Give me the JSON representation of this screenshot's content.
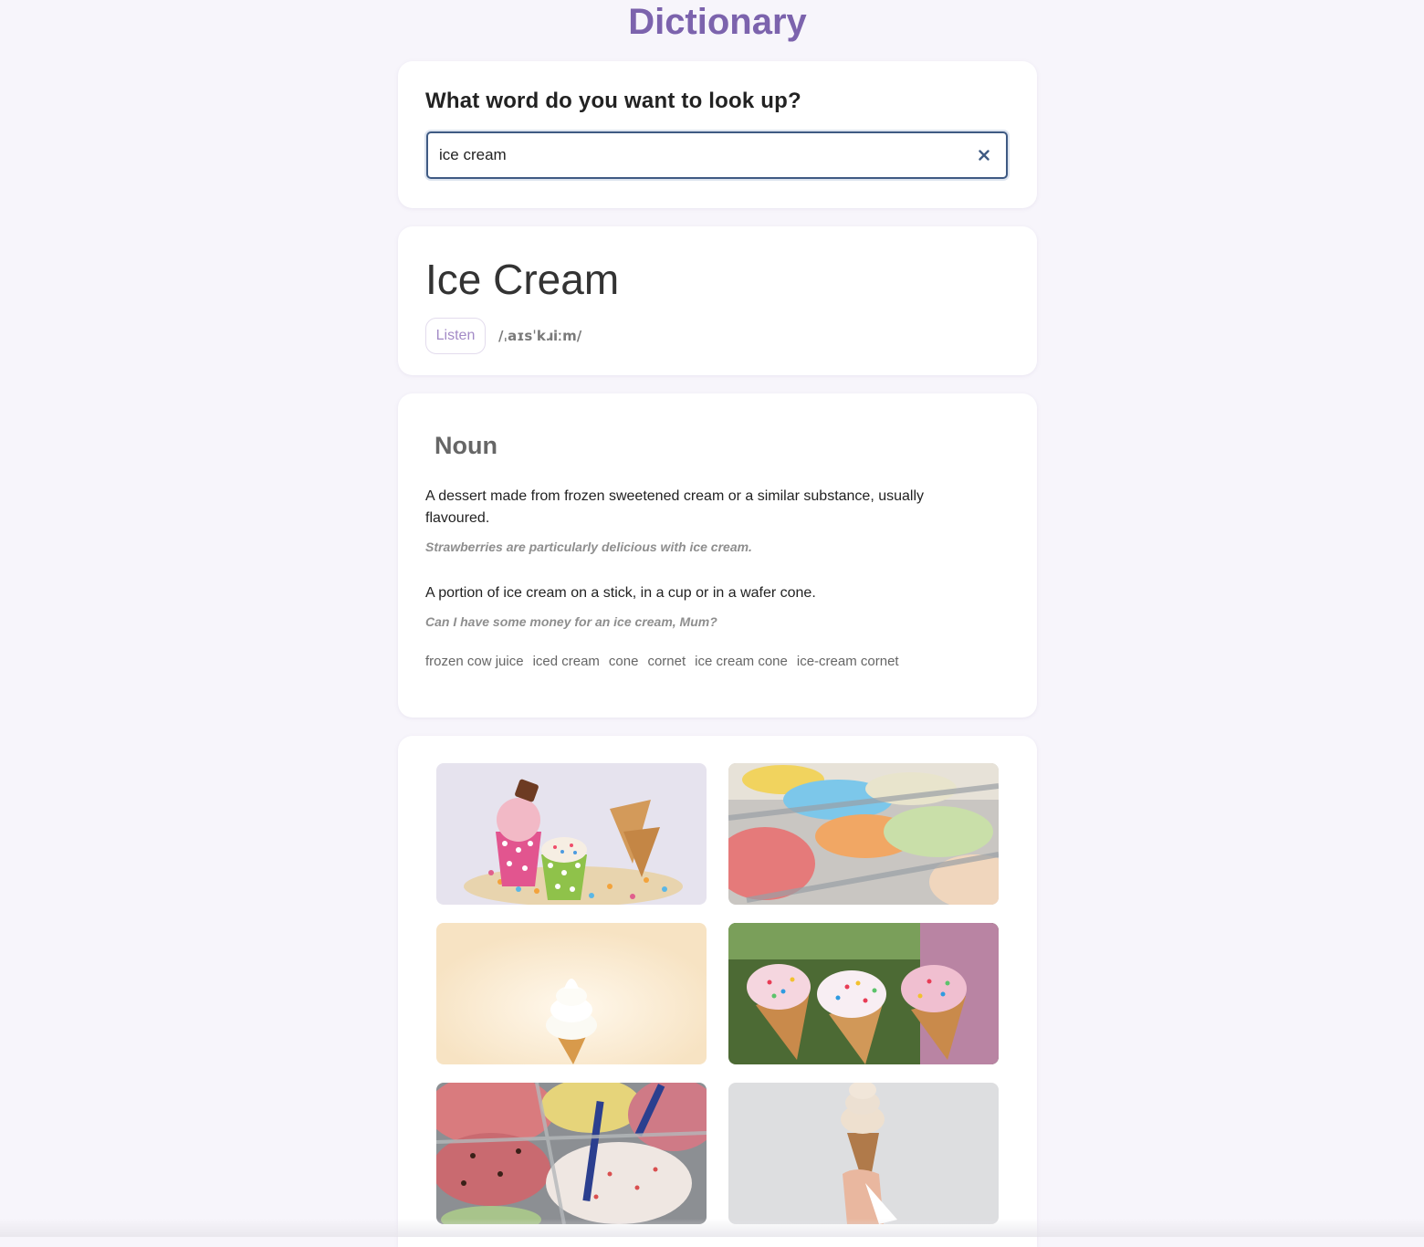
{
  "app": {
    "title": "Dictionary"
  },
  "search": {
    "heading": "What word do you want to look up?",
    "value": "ice cream",
    "clear_icon": "close-icon"
  },
  "word": {
    "title": "Ice Cream",
    "listen_label": "Listen",
    "phonetic": "/ˌaɪsˈkɹiːm/"
  },
  "meaning": {
    "part_of_speech": "Noun",
    "definitions": [
      {
        "text": "A dessert made from frozen sweetened cream or a similar substance, usually flavoured.",
        "example": "Strawberries are particularly delicious with ice cream."
      },
      {
        "text": "A portion of ice cream on a stick, in a cup or in a wafer cone.",
        "example": "Can I have some money for an ice cream, Mum?"
      }
    ],
    "synonyms": [
      "frozen cow juice",
      "iced cream",
      "cone",
      "cornet",
      "ice cream cone",
      "ice-cream cornet"
    ]
  },
  "colors": {
    "brand": "#7c63ad",
    "background": "#f7f5fb",
    "input_border": "#3f5a83",
    "listen_text": "#a38ac6"
  }
}
